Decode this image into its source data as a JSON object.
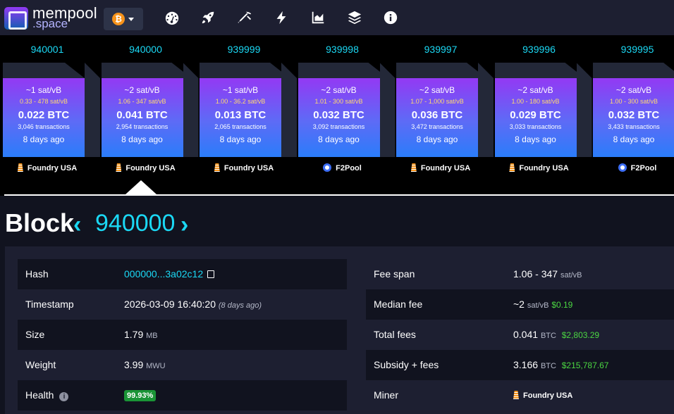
{
  "header": {
    "logo_main": "mempool",
    "logo_sub": ".space",
    "network_symbol": "₿",
    "nav_icons": [
      "dashboard-icon",
      "rocket-icon",
      "pickaxe-icon",
      "lightning-icon",
      "chart-icon",
      "layers-icon",
      "info-icon"
    ]
  },
  "blocks": [
    {
      "height": "940001",
      "median_fee": "~1 sat/vB",
      "fee_range": "0.33 - 478 sat/vB",
      "total": "0.022 BTC",
      "tx_count": "3,046 transactions",
      "ago": "8 days ago",
      "pool": "Foundry USA",
      "pool_icon": "foundry"
    },
    {
      "height": "940000",
      "median_fee": "~2 sat/vB",
      "fee_range": "1.06 - 347 sat/vB",
      "total": "0.041 BTC",
      "tx_count": "2,954 transactions",
      "ago": "8 days ago",
      "pool": "Foundry USA",
      "pool_icon": "foundry"
    },
    {
      "height": "939999",
      "median_fee": "~1 sat/vB",
      "fee_range": "1.00 - 36.2 sat/vB",
      "total": "0.013 BTC",
      "tx_count": "2,065 transactions",
      "ago": "8 days ago",
      "pool": "Foundry USA",
      "pool_icon": "foundry"
    },
    {
      "height": "939998",
      "median_fee": "~2 sat/vB",
      "fee_range": "1.01 - 300 sat/vB",
      "total": "0.032 BTC",
      "tx_count": "3,092 transactions",
      "ago": "8 days ago",
      "pool": "F2Pool",
      "pool_icon": "f2"
    },
    {
      "height": "939997",
      "median_fee": "~2 sat/vB",
      "fee_range": "1.07 - 1,000 sat/vB",
      "total": "0.036 BTC",
      "tx_count": "3,472 transactions",
      "ago": "8 days ago",
      "pool": "Foundry USA",
      "pool_icon": "foundry"
    },
    {
      "height": "939996",
      "median_fee": "~2 sat/vB",
      "fee_range": "1.00 - 180 sat/vB",
      "total": "0.029 BTC",
      "tx_count": "3,033 transactions",
      "ago": "8 days ago",
      "pool": "Foundry USA",
      "pool_icon": "foundry"
    },
    {
      "height": "939995",
      "median_fee": "~2 sat/vB",
      "fee_range": "1.00 - 300 sat/vB",
      "total": "0.032 BTC",
      "tx_count": "3,433 transactions",
      "ago": "8 days ago",
      "pool": "F2Pool",
      "pool_icon": "f2"
    }
  ],
  "block_page": {
    "title": "Block",
    "prev_arrow": "‹",
    "next_arrow": "›",
    "height": "940000",
    "left": {
      "hash_label": "Hash",
      "hash_value": "000000...3a02c12",
      "timestamp_label": "Timestamp",
      "timestamp_value": "2026-03-09 16:40:20",
      "timestamp_ago": "(8 days ago)",
      "size_label": "Size",
      "size_value": "1.79",
      "size_unit": "MB",
      "weight_label": "Weight",
      "weight_value": "3.99",
      "weight_unit": "MWU",
      "health_label": "Health",
      "health_value": "99.93%"
    },
    "right": {
      "fee_span_label": "Fee span",
      "fee_span_value": "1.06 - 347",
      "fee_span_unit": "sat/vB",
      "median_fee_label": "Median fee",
      "median_fee_value": "~2",
      "median_fee_unit": "sat/vB",
      "median_fee_fiat": "$0.19",
      "total_fees_label": "Total fees",
      "total_fees_value": "0.041",
      "total_fees_unit": "BTC",
      "total_fees_fiat": "$2,803.29",
      "subsidy_label": "Subsidy + fees",
      "subsidy_value": "3.166",
      "subsidy_unit": "BTC",
      "subsidy_fiat": "$215,787.67",
      "miner_label": "Miner",
      "miner_value": "Foundry USA"
    }
  },
  "colors": {
    "accent": "#1bd8f4",
    "fiat": "#4bd742",
    "health": "#1a9436",
    "fee_range": "#fedc6f"
  }
}
